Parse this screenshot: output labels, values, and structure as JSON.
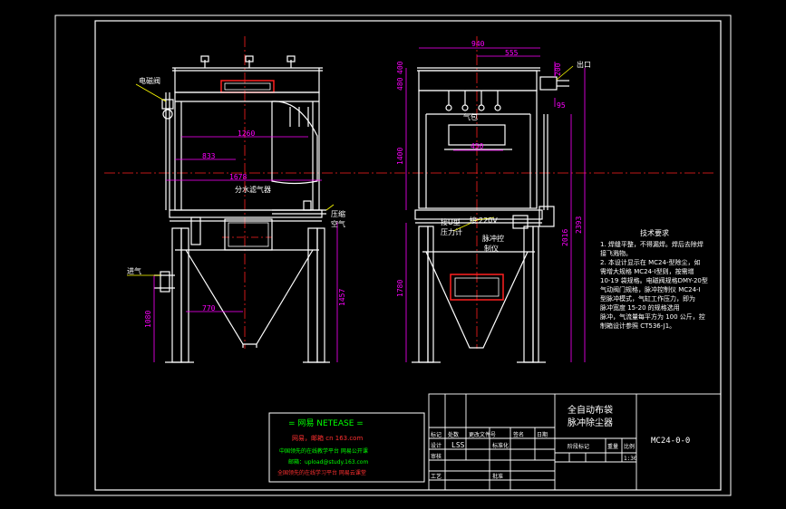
{
  "colors": {
    "background": "#000000",
    "frame": "#ffffff",
    "centerline": "#ff2020",
    "dimension": "#ff00ff",
    "text": "#ffffff",
    "leader": "#ffff00",
    "hidden": "#00ffff",
    "green": "#00ff00"
  },
  "labels": {
    "valve": "电磁阀",
    "inlet": "进气",
    "outlet": "出口",
    "oil_water": "分水滤气器",
    "compressed": "压缩",
    "air": "空气",
    "air_bag": "气包",
    "u_tube": "接U型",
    "pressure_gauge": "压力计",
    "connect": "接",
    "voltage": "220V",
    "pulse_ctrl": "脉冲控",
    "ctrl_box": "制仪"
  },
  "dimensions": {
    "d1260": "1260",
    "d833": "833",
    "d1678": "1678",
    "d770": "770",
    "d1080": "1080",
    "d1457": "1457",
    "d940": "940",
    "d555": "555",
    "d200": "200",
    "d95": "95",
    "d450": "450",
    "d480": "480",
    "d400": "400",
    "d1400": "1400",
    "d1780": "1780",
    "d2016": "2016",
    "d2393": "2393"
  },
  "notes": {
    "title": "技术要求",
    "lines": [
      "1. 焊缝平整，不得漏焊。焊后去除焊",
      "   接飞溅物。",
      "2. 本设计显示在 MC24-型除尘，如",
      "   需增大规格 MC24-I型则，按需增",
      "   10-19 袋规格。电磁阀规格DMY-20型",
      "   气动阀门规格，脉冲控制仪 MC24-I",
      "   型脉冲模式，气缸工作压力，即为",
      "   脉冲宽度 15-20 的规格选用",
      "   脉冲，气流量每平方为 100 公斤，控",
      "   制箱设计参照 CT536-J1。"
    ]
  },
  "stamp": {
    "header": "= 网易 NETEASE =",
    "line1": "网易，邮箱  cn 163.com",
    "line2": "中国领先的在线教学平台 网易公开课",
    "line3": "邮箱：upload@study.163.com",
    "line4": "全国领先的在线学习平台 网易云课堂"
  },
  "title_block": {
    "title_line1": "全自动布袋",
    "title_line2": "脉冲除尘器",
    "drawing_no": "MC24-0-0",
    "rows": [
      [
        "标记",
        "处数",
        "更改文件号",
        "签名",
        "日期"
      ],
      [
        "设计",
        "LSS",
        "标准化"
      ],
      [
        "审核",
        "",
        "",
        "",
        "",
        ""
      ],
      [
        "工艺",
        "",
        "批准"
      ]
    ],
    "stage_label": "阶段标记",
    "weight_label": "重量",
    "scale_label": "比例",
    "scale_value": "1:30"
  }
}
